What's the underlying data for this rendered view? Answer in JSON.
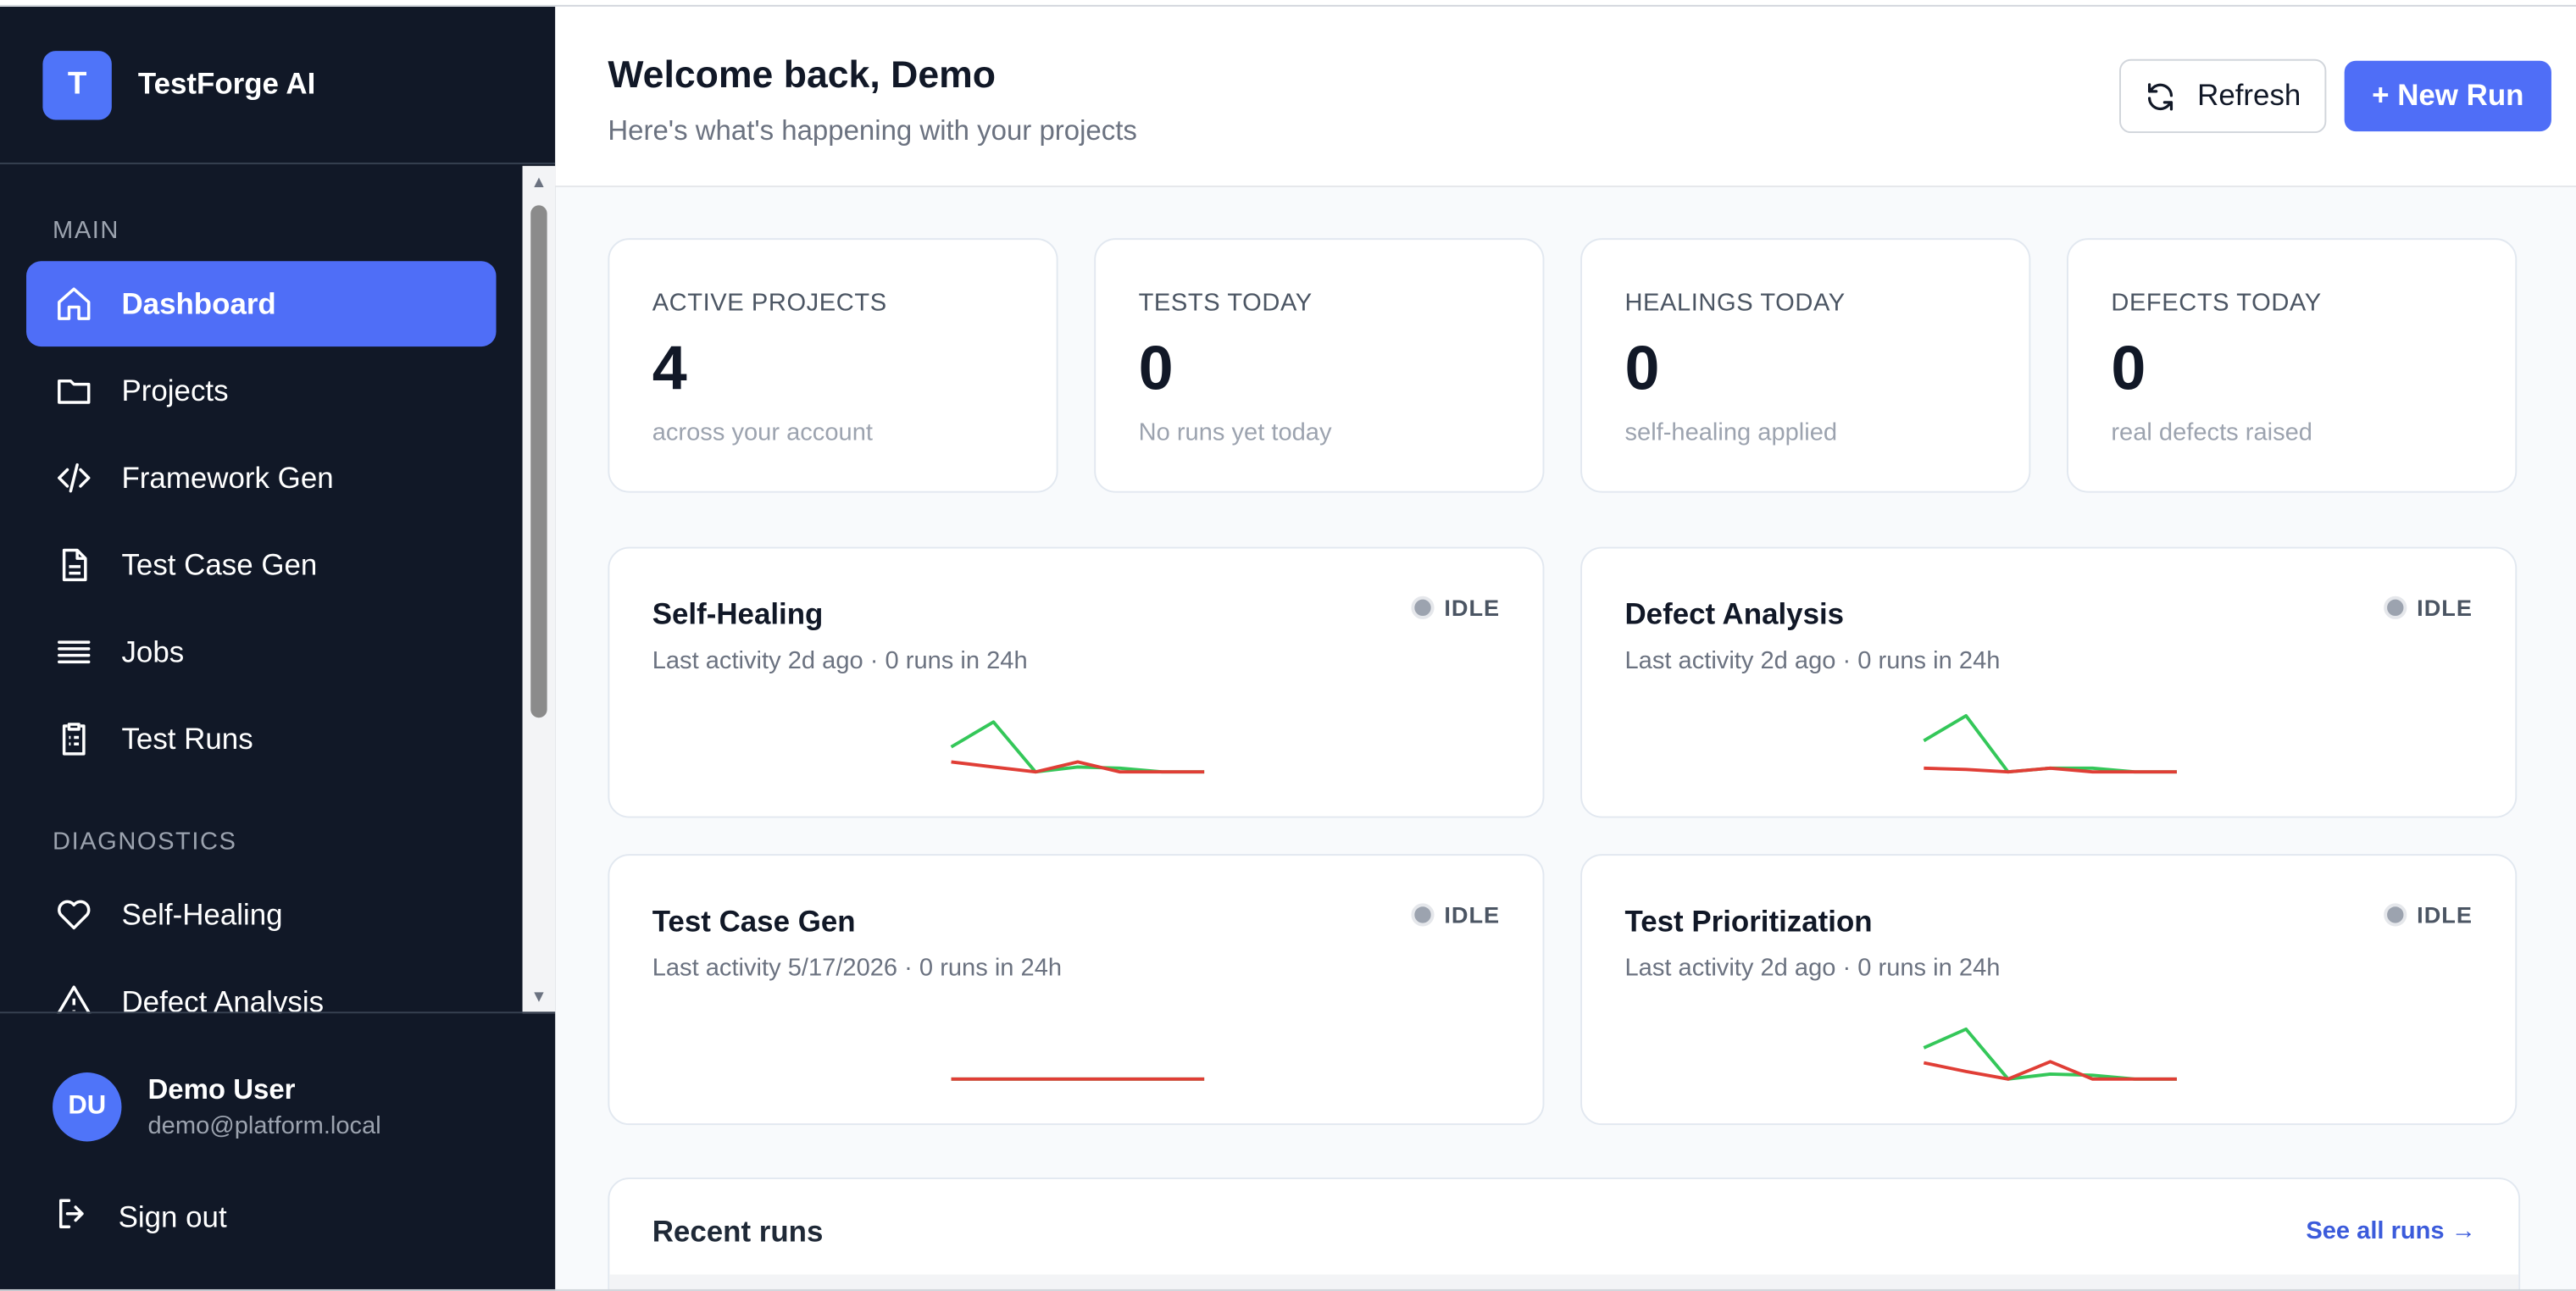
{
  "brand": {
    "logo_letter": "T",
    "name": "TestForge AI",
    "accent": "#4f6ef7"
  },
  "sidebar": {
    "sections": [
      {
        "title": "MAIN"
      },
      {
        "title": "DIAGNOSTICS"
      }
    ],
    "items": [
      {
        "label": "Dashboard",
        "icon": "home-icon",
        "active": true
      },
      {
        "label": "Projects",
        "icon": "folder-icon"
      },
      {
        "label": "Framework Gen",
        "icon": "code-icon"
      },
      {
        "label": "Test Case Gen",
        "icon": "document-icon"
      },
      {
        "label": "Jobs",
        "icon": "list-icon"
      },
      {
        "label": "Test Runs",
        "icon": "clipboard-icon"
      },
      {
        "label": "Self-Healing",
        "icon": "heart-icon"
      },
      {
        "label": "Defect Analysis",
        "icon": "warning-icon"
      }
    ]
  },
  "user": {
    "initials": "DU",
    "name": "Demo User",
    "email": "demo@platform.local",
    "signout_label": "Sign out"
  },
  "header": {
    "title": "Welcome back, Demo",
    "subtitle": "Here's what's happening with your projects",
    "refresh_label": "Refresh",
    "new_run_label": "+ New Run"
  },
  "stats": [
    {
      "label": "ACTIVE PROJECTS",
      "value": "4",
      "note": "across your account"
    },
    {
      "label": "TESTS TODAY",
      "value": "0",
      "note": "No runs yet today"
    },
    {
      "label": "HEALINGS TODAY",
      "value": "0",
      "note": "self-healing applied"
    },
    {
      "label": "DEFECTS TODAY",
      "value": "0",
      "note": "real defects raised"
    }
  ],
  "cards": [
    {
      "title": "Self-Healing",
      "subtitle": "Last activity 2d ago · 0 runs in 24h",
      "status": "IDLE",
      "green": [
        2,
        4,
        0,
        0.4,
        0.3,
        0,
        0
      ],
      "red": [
        0.8,
        0.4,
        0,
        0.8,
        0,
        0,
        0
      ]
    },
    {
      "title": "Defect Analysis",
      "subtitle": "Last activity 2d ago · 0 runs in 24h",
      "status": "IDLE",
      "green": [
        2.5,
        4.5,
        0,
        0.3,
        0.3,
        0,
        0
      ],
      "red": [
        0.3,
        0.2,
        0,
        0.3,
        0,
        0,
        0
      ]
    },
    {
      "title": "Test Case Gen",
      "subtitle": "Last activity 5/17/2026 · 0 runs in 24h",
      "status": "IDLE",
      "green": [
        0,
        0,
        0,
        0,
        0,
        0,
        0
      ],
      "red": [
        0,
        0,
        0,
        0,
        0,
        0,
        0
      ]
    },
    {
      "title": "Test Prioritization",
      "subtitle": "Last activity 2d ago · 0 runs in 24h",
      "status": "IDLE",
      "green": [
        2.5,
        4,
        0,
        0.4,
        0.3,
        0,
        0
      ],
      "red": [
        1.3,
        0.6,
        0,
        1.4,
        0,
        0,
        0
      ]
    }
  ],
  "spark_colors": {
    "green": "#34c759",
    "red": "#e03e36"
  },
  "recent": {
    "title": "Recent runs",
    "link": "See all runs →"
  }
}
